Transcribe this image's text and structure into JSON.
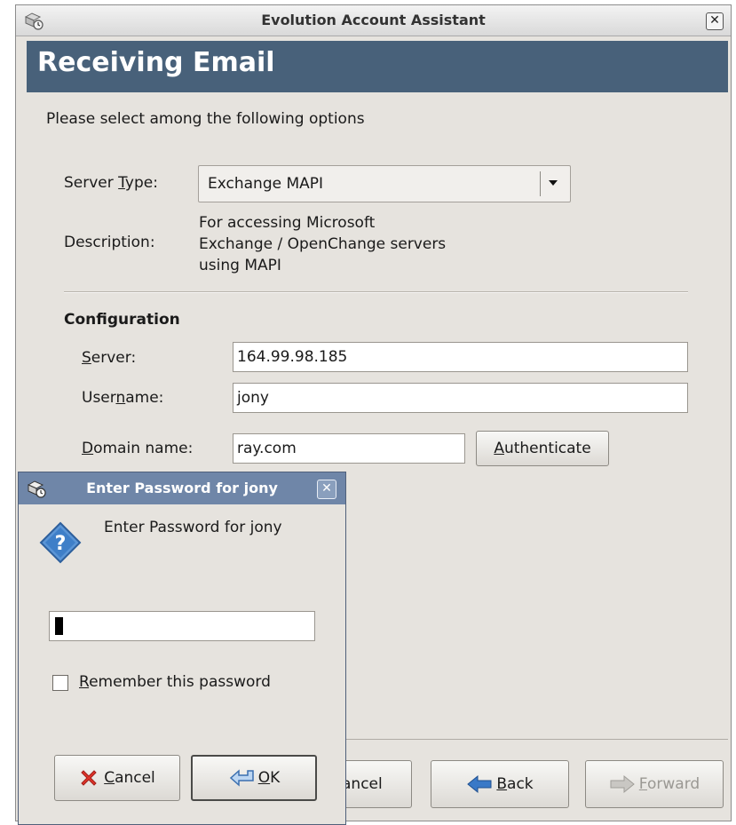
{
  "window": {
    "title": "Evolution Account Assistant",
    "close_symbol": "✕"
  },
  "page": {
    "heading": "Receiving Email",
    "intro": "Please select among the following options"
  },
  "server_type": {
    "label_pre": "Server ",
    "label_mnemonic": "T",
    "label_post": "ype:",
    "value": "Exchange MAPI"
  },
  "description": {
    "label": "Description:",
    "lines": [
      "For accessing Microsoft",
      "Exchange / OpenChange servers",
      "using MAPI"
    ]
  },
  "configuration": {
    "heading": "Configuration",
    "server": {
      "label_mnemonic": "S",
      "label_rest": "erver:",
      "value": "164.99.98.185"
    },
    "username": {
      "label_pre": "User",
      "label_mnemonic": "n",
      "label_post": "ame:",
      "value": "jony"
    },
    "domain": {
      "label_mnemonic": "D",
      "label_rest": "omain name:",
      "value": "ray.com"
    },
    "authenticate": {
      "label_mnemonic": "A",
      "label_rest": "uthenticate"
    }
  },
  "footer": {
    "cancel_partial": "ancel",
    "back": {
      "mnemonic": "B",
      "rest": "ack"
    },
    "forward": {
      "mnemonic": "F",
      "rest": "orward"
    }
  },
  "password_dialog": {
    "title": "Enter Password for jony",
    "close_symbol": "✕",
    "prompt": "Enter Password for jony",
    "icon_symbol": "?",
    "password_value": "",
    "remember": {
      "mnemonic": "R",
      "rest": "emember this password",
      "checked": false
    },
    "cancel": {
      "mnemonic": "C",
      "rest": "ancel"
    },
    "ok": {
      "mnemonic": "O",
      "rest": "K"
    }
  },
  "colors": {
    "header_bg": "#48617a",
    "dialog_title_bg": "#6f86a8",
    "window_bg": "#e6e3de"
  }
}
